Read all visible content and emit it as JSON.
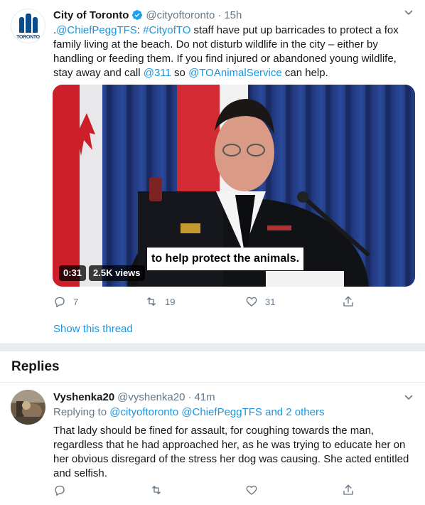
{
  "tweet": {
    "author_name": "City of Toronto",
    "author_handle": "@cityoftoronto",
    "separator": "·",
    "time": "15h",
    "avatar_wordmark": "TORONTO",
    "text_segments": [
      {
        "text": ".",
        "link": false
      },
      {
        "text": "@ChiefPeggTFS",
        "link": true
      },
      {
        "text": ": ",
        "link": false
      },
      {
        "text": "#CityofTO",
        "link": true
      },
      {
        "text": " staff have put up barricades to protect a fox family living at the beach. Do not disturb wildlife in the city – either by handling or feeding them. If you find injured or abandoned young wildlife, stay away and call ",
        "link": false
      },
      {
        "text": "@311",
        "link": true
      },
      {
        "text": " so ",
        "link": false
      },
      {
        "text": "@TOAnimalService",
        "link": true
      },
      {
        "text": " can help.",
        "link": false
      }
    ],
    "video": {
      "caption": "to help protect the animals.",
      "duration": "0:31",
      "views": "2.5K views"
    },
    "actions": {
      "replies": "7",
      "retweets": "19",
      "likes": "31"
    },
    "show_thread": "Show this thread"
  },
  "replies_heading": "Replies",
  "reply": {
    "author_name": "Vyshenka20",
    "author_handle": "@vyshenka20",
    "separator": "·",
    "time": "41m",
    "replying_prefix": "Replying to ",
    "replying_to": "@cityoftoronto @ChiefPeggTFS and 2 others",
    "text": "That lady should be fined for assault, for coughing towards the man, regardless that he had approached her, as he was trying to educate her on her obvious disregard of the stress her dog was causing.  She acted entitled and selfish."
  },
  "colors": {
    "link": "#1b95e0",
    "secondary": "#657786",
    "text": "#14171a",
    "divider": "#e6ecf0",
    "verified": "#1da1f2"
  }
}
